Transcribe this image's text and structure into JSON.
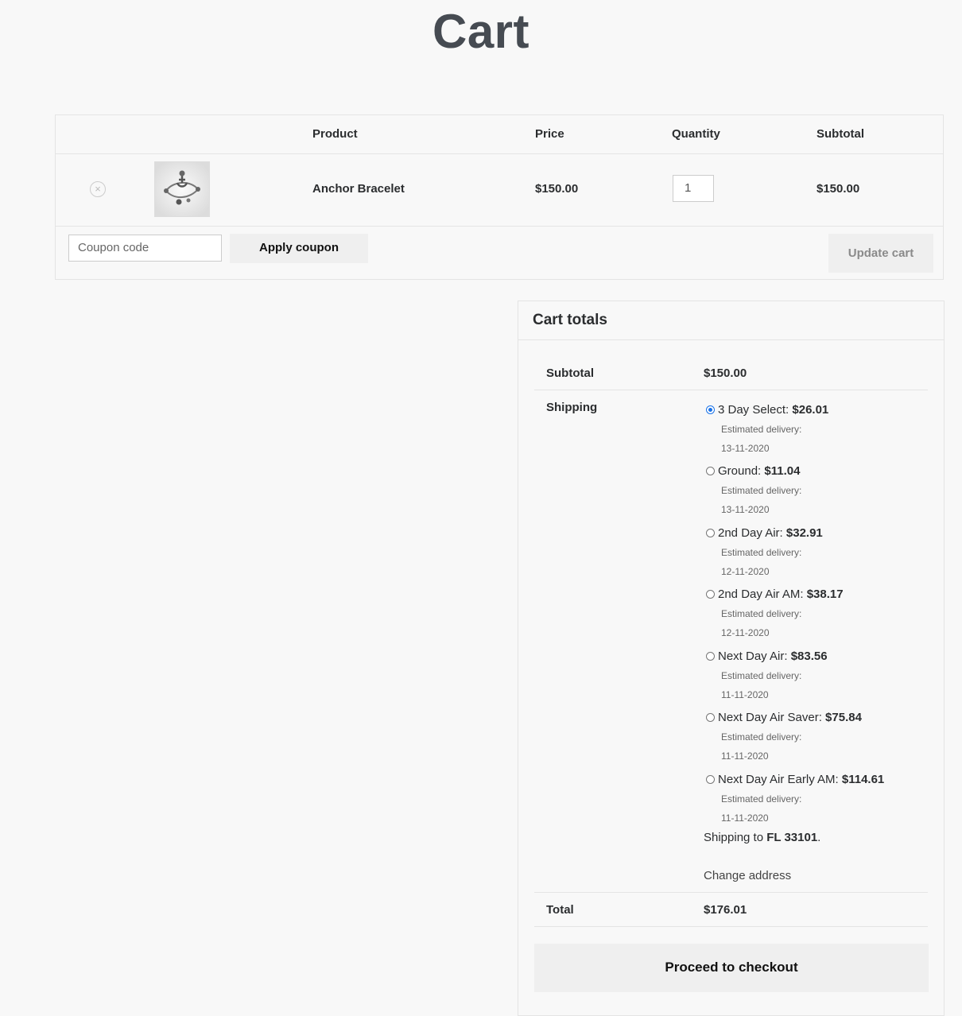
{
  "page": {
    "title": "Cart"
  },
  "table": {
    "headers": {
      "product": "Product",
      "price": "Price",
      "quantity": "Quantity",
      "subtotal": "Subtotal"
    },
    "row": {
      "remove_icon": "×",
      "product": "Anchor Bracelet",
      "price": "$150.00",
      "quantity": "1",
      "subtotal": "$150.00"
    },
    "coupon_placeholder": "Coupon code",
    "apply_label": "Apply coupon",
    "update_label": "Update cart"
  },
  "totals": {
    "title": "Cart totals",
    "subtotal_label": "Subtotal",
    "subtotal_value": "$150.00",
    "shipping_label": "Shipping",
    "shipping_options": [
      {
        "name": "3 Day Select: ",
        "price": "$26.01",
        "eta_label": "Estimated delivery:",
        "eta_date": "13-11-2020",
        "selected": true
      },
      {
        "name": "Ground: ",
        "price": "$11.04",
        "eta_label": "Estimated delivery:",
        "eta_date": "13-11-2020",
        "selected": false
      },
      {
        "name": "2nd Day Air: ",
        "price": "$32.91",
        "eta_label": "Estimated delivery:",
        "eta_date": "12-11-2020",
        "selected": false
      },
      {
        "name": "2nd Day Air AM: ",
        "price": "$38.17",
        "eta_label": "Estimated delivery:",
        "eta_date": "12-11-2020",
        "selected": false
      },
      {
        "name": "Next Day Air: ",
        "price": "$83.56",
        "eta_label": "Estimated delivery:",
        "eta_date": "11-11-2020",
        "selected": false
      },
      {
        "name": "Next Day Air Saver: ",
        "price": "$75.84",
        "eta_label": "Estimated delivery:",
        "eta_date": "11-11-2020",
        "selected": false
      },
      {
        "name": "Next Day Air Early AM: ",
        "price": "$114.61",
        "eta_label": "Estimated delivery:",
        "eta_date": "11-11-2020",
        "selected": false
      }
    ],
    "shipping_to_prefix": "Shipping to ",
    "shipping_to_location": "FL 33101",
    "shipping_to_suffix": ".",
    "change_address": "Change address",
    "total_label": "Total",
    "total_value": "$176.01",
    "checkout_label": "Proceed to checkout"
  }
}
